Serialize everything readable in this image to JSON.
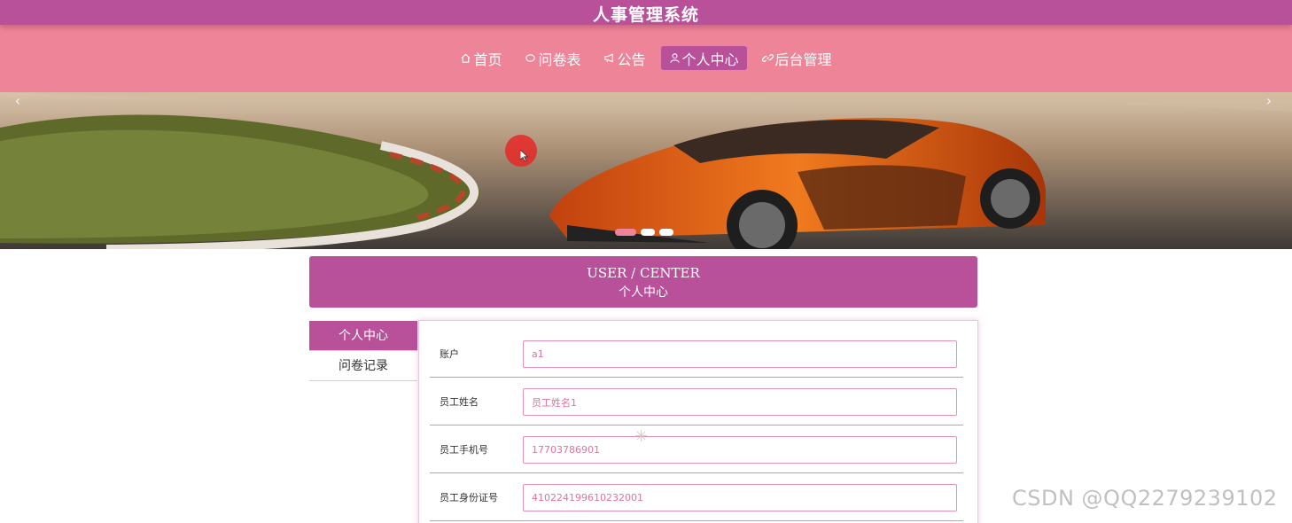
{
  "header": {
    "title": "人事管理系统"
  },
  "nav": {
    "items": [
      {
        "label": "首页",
        "icon": "home-icon",
        "active": false
      },
      {
        "label": "问卷表",
        "icon": "chat-icon",
        "active": false
      },
      {
        "label": "公告",
        "icon": "megaphone-icon",
        "active": false
      },
      {
        "label": "个人中心",
        "icon": "user-icon",
        "active": true
      },
      {
        "label": "后台管理",
        "icon": "link-icon",
        "active": false
      }
    ]
  },
  "banner": {
    "arrow_left": "‹",
    "arrow_right": "›",
    "slides": 3,
    "active_slide": 1
  },
  "center": {
    "title_en": "USER / CENTER",
    "title_cn": "个人中心"
  },
  "side_menu": {
    "items": [
      {
        "label": "个人中心",
        "active": true
      },
      {
        "label": "问卷记录",
        "active": false
      }
    ]
  },
  "form": {
    "fields": [
      {
        "label": "账户",
        "value": "a1"
      },
      {
        "label": "员工姓名",
        "value": "员工姓名1"
      },
      {
        "label": "员工手机号",
        "value": "17703786901"
      },
      {
        "label": "员工身份证号",
        "value": "410224199610232001"
      }
    ]
  },
  "watermark": "CSDN @QQ2279239102",
  "colors": {
    "primary": "#b9509a",
    "nav_bg": "#ee8498",
    "field_text": "#e0729d"
  }
}
